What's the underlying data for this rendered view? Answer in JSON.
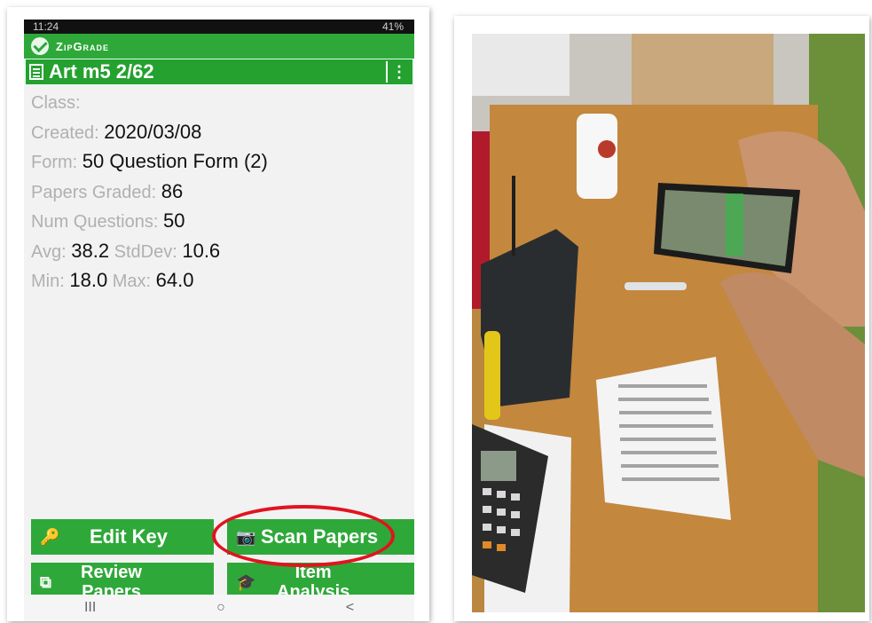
{
  "status_bar": {
    "time": "11:24",
    "battery": "41%"
  },
  "app": {
    "brand": "ZipGrade"
  },
  "quiz": {
    "title": "Art m5 2/62"
  },
  "details": {
    "class_label": "Class:",
    "class_value": "",
    "created_label": "Created:",
    "created_value": "2020/03/08",
    "form_label": "Form:",
    "form_value": "50 Question Form (2)",
    "graded_label": "Papers Graded:",
    "graded_value": "86",
    "numq_label": "Num Questions:",
    "numq_value": "50",
    "avg_label": "Avg:",
    "avg_value": "38.2",
    "std_label": "StdDev:",
    "std_value": "10.6",
    "min_label": "Min:",
    "min_value": "18.0",
    "max_label": "Max:",
    "max_value": "64.0"
  },
  "buttons": {
    "edit_key": "Edit Key",
    "scan_papers": "Scan Papers",
    "review_line1": "Review",
    "review_line2": "Papers",
    "item_line1": "Item",
    "item_line2": "Analysis"
  },
  "navbar": {
    "recent": "III",
    "home": "○",
    "back": "<"
  },
  "colors": {
    "accent_green": "#2fa83a",
    "highlight_red": "#e0141f"
  }
}
